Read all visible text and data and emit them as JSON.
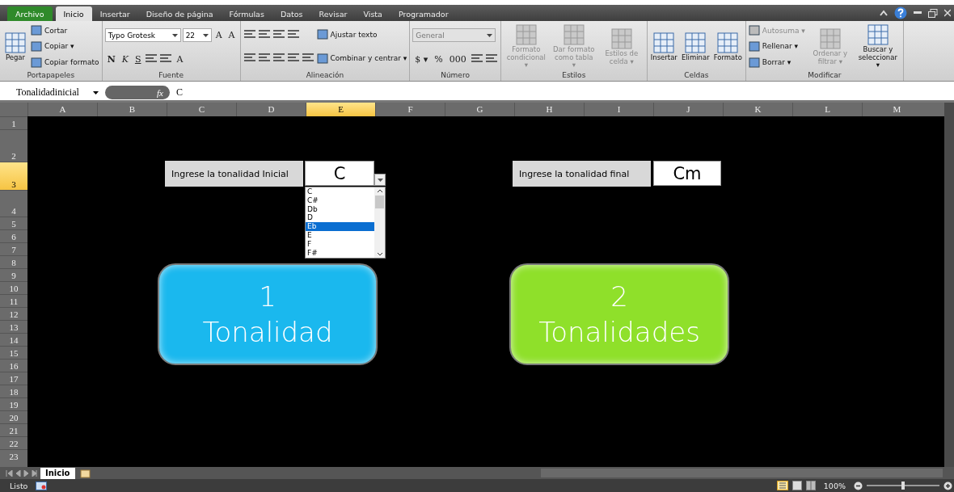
{
  "menu_tabs": [
    {
      "label": "Archivo",
      "kind": "file",
      "selected": false
    },
    {
      "label": "Inicio",
      "kind": "tab",
      "selected": true
    },
    {
      "label": "Insertar",
      "kind": "tab",
      "selected": false
    },
    {
      "label": "Diseño de página",
      "kind": "tab",
      "selected": false
    },
    {
      "label": "Fórmulas",
      "kind": "tab",
      "selected": false
    },
    {
      "label": "Datos",
      "kind": "tab",
      "selected": false
    },
    {
      "label": "Revisar",
      "kind": "tab",
      "selected": false
    },
    {
      "label": "Vista",
      "kind": "tab",
      "selected": false
    },
    {
      "label": "Programador",
      "kind": "tab",
      "selected": false
    }
  ],
  "ribbon": [
    {
      "label": "Portapapeles",
      "columns": [
        [
          [
            {
              "kind": "large",
              "label": "Pegar",
              "disabled": false
            }
          ]
        ],
        [
          [
            {
              "kind": "small",
              "label": "Cortar",
              "disabled": false
            }
          ],
          [
            {
              "kind": "small",
              "label": "Copiar ▾",
              "disabled": false
            }
          ],
          [
            {
              "kind": "small",
              "label": "Copiar formato",
              "disabled": false
            }
          ]
        ]
      ]
    },
    {
      "label": "Fuente",
      "columns": [
        [
          [
            {
              "kind": "combo",
              "label": "Typo Grotesk",
              "disabled": false
            },
            {
              "kind": "combo",
              "label": "22",
              "disabled": false
            },
            {
              "kind": "plain",
              "label": "A",
              "disabled": false
            },
            {
              "kind": "plain",
              "label": "A",
              "disabled": false
            }
          ],
          [
            {
              "kind": "bold",
              "label": "N",
              "disabled": false
            },
            {
              "kind": "italic",
              "label": "K",
              "disabled": false
            },
            {
              "kind": "underline",
              "label": "S",
              "disabled": false
            },
            {
              "kind": "tool"
            },
            {
              "kind": "tool"
            },
            {
              "kind": "plain",
              "label": "A",
              "disabled": false
            }
          ]
        ]
      ]
    },
    {
      "label": "Alineación",
      "columns": [
        [
          [
            {
              "kind": "tool"
            },
            {
              "kind": "tool"
            },
            {
              "kind": "tool"
            },
            {
              "kind": "tool"
            }
          ],
          [
            {
              "kind": "tool"
            },
            {
              "kind": "tool"
            },
            {
              "kind": "tool"
            },
            {
              "kind": "tool"
            },
            {
              "kind": "tool"
            }
          ]
        ],
        [
          [
            {
              "kind": "small",
              "label": "Ajustar texto",
              "disabled": false
            }
          ],
          [
            {
              "kind": "small",
              "label": "Combinar y centrar ▾",
              "disabled": false
            }
          ]
        ]
      ]
    },
    {
      "label": "Número",
      "columns": [
        [
          [
            {
              "kind": "combo",
              "label": "General",
              "disabled": true
            }
          ],
          [
            {
              "kind": "plain",
              "label": "$ ▾",
              "disabled": false
            },
            {
              "kind": "plain",
              "label": "%",
              "disabled": false
            },
            {
              "kind": "plain",
              "label": "000",
              "disabled": false
            },
            {
              "kind": "tool"
            },
            {
              "kind": "tool"
            }
          ]
        ]
      ]
    },
    {
      "label": "Estilos",
      "columns": [
        [
          [
            {
              "kind": "large",
              "label": "Formato condicional ▾",
              "disabled": true
            }
          ]
        ],
        [
          [
            {
              "kind": "large",
              "label": "Dar formato como tabla ▾",
              "disabled": true
            }
          ]
        ],
        [
          [
            {
              "kind": "large",
              "label": "Estilos de celda ▾",
              "disabled": true
            }
          ]
        ]
      ]
    },
    {
      "label": "Celdas",
      "columns": [
        [
          [
            {
              "kind": "large",
              "label": "Insertar",
              "disabled": false
            }
          ]
        ],
        [
          [
            {
              "kind": "large",
              "label": "Eliminar",
              "disabled": false
            }
          ]
        ],
        [
          [
            {
              "kind": "large",
              "label": "Formato",
              "disabled": false
            }
          ]
        ]
      ]
    },
    {
      "label": "Modificar",
      "columns": [
        [
          [
            {
              "kind": "small",
              "label": "Autosuma ▾",
              "disabled": true
            }
          ],
          [
            {
              "kind": "small",
              "label": "Rellenar ▾",
              "disabled": false
            }
          ],
          [
            {
              "kind": "small",
              "label": "Borrar ▾",
              "disabled": false
            }
          ]
        ],
        [
          [
            {
              "kind": "large",
              "label": "Ordenar y filtrar ▾",
              "disabled": true
            }
          ]
        ],
        [
          [
            {
              "kind": "large",
              "label": "Buscar y seleccionar ▾",
              "disabled": false
            }
          ]
        ]
      ]
    }
  ],
  "name_box": "Tonalidadinicial",
  "function_label": "fx",
  "formula": "C",
  "columns": [
    {
      "label": "A",
      "selected": false
    },
    {
      "label": "B",
      "selected": false
    },
    {
      "label": "C",
      "selected": false
    },
    {
      "label": "D",
      "selected": false
    },
    {
      "label": "E",
      "selected": true
    },
    {
      "label": "F",
      "selected": false
    },
    {
      "label": "G",
      "selected": false
    },
    {
      "label": "H",
      "selected": false
    },
    {
      "label": "I",
      "selected": false
    },
    {
      "label": "J",
      "selected": false
    },
    {
      "label": "K",
      "selected": false
    },
    {
      "label": "L",
      "selected": false
    },
    {
      "label": "M",
      "selected": false
    }
  ],
  "rows": [
    {
      "label": "1",
      "selected": false
    },
    {
      "label": "2",
      "selected": false
    },
    {
      "label": "3",
      "selected": true
    },
    {
      "label": "4",
      "selected": false
    },
    {
      "label": "5",
      "selected": false
    },
    {
      "label": "6",
      "selected": false
    },
    {
      "label": "7",
      "selected": false
    },
    {
      "label": "8",
      "selected": false
    },
    {
      "label": "9",
      "selected": false
    },
    {
      "label": "10",
      "selected": false
    },
    {
      "label": "11",
      "selected": false
    },
    {
      "label": "12",
      "selected": false
    },
    {
      "label": "13",
      "selected": false
    },
    {
      "label": "14",
      "selected": false
    },
    {
      "label": "15",
      "selected": false
    },
    {
      "label": "16",
      "selected": false
    },
    {
      "label": "17",
      "selected": false
    },
    {
      "label": "18",
      "selected": false
    },
    {
      "label": "19",
      "selected": false
    },
    {
      "label": "20",
      "selected": false
    },
    {
      "label": "21",
      "selected": false
    },
    {
      "label": "22",
      "selected": false
    },
    {
      "label": "23",
      "selected": false
    }
  ],
  "initial": {
    "label": "Ingrese la tonalidad Inicial",
    "value": "C"
  },
  "final": {
    "label": "Ingrese la tonalidad final",
    "value": "Cm"
  },
  "dropdown": [
    {
      "label": "C",
      "selected": false
    },
    {
      "label": "C#",
      "selected": false
    },
    {
      "label": "Db",
      "selected": false
    },
    {
      "label": "D",
      "selected": false
    },
    {
      "label": "Eb",
      "selected": true
    },
    {
      "label": "E",
      "selected": false
    },
    {
      "label": "F",
      "selected": false
    },
    {
      "label": "F#",
      "selected": false
    }
  ],
  "shapes": [
    {
      "number": "1",
      "label": "Tonalidad",
      "color": "#1ab8ee"
    },
    {
      "number": "2",
      "label": "Tonalidades",
      "color": "#8fe02a"
    }
  ],
  "sheet_tabs": [
    {
      "label": "Inicio",
      "selected": true
    }
  ],
  "status": "Listo",
  "zoom": "100%",
  "zoom_slider": {
    "level": 0.5
  }
}
